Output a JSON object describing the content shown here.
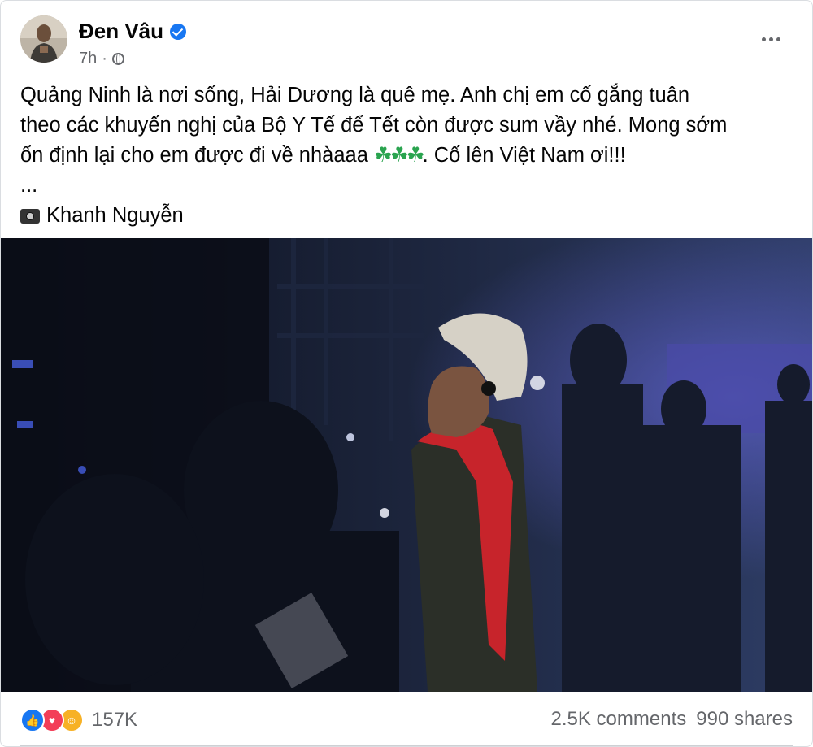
{
  "post": {
    "author": "Đen Vâu",
    "time": "7h",
    "separator": "·",
    "text_lines": [
      "Quảng Ninh là nơi sống, Hải Dương là quê mẹ. Anh chị em cố gắng tuân",
      "theo các khuyến nghị của Bộ Y Tế để Tết còn được sum vầy nhé. Mong sớm",
      "ổn định lại cho em được đi về nhàaaa",
      ". Cố lên Việt Nam ơi!!!"
    ],
    "clovers": "☘☘☘",
    "ellipsis": "...",
    "photo_credit": "Khanh Nguyễn"
  },
  "footer": {
    "reaction_count": "157K",
    "comments": "2.5K comments",
    "shares": "990 shares"
  },
  "icons": [
    "verified-badge-icon",
    "globe-icon",
    "more-options-icon",
    "camera-icon",
    "like-reaction-icon",
    "love-reaction-icon",
    "care-reaction-icon"
  ],
  "colors": {
    "accent": "#1877f2",
    "love": "#f33e58",
    "care": "#f7b125",
    "muted": "#65676b"
  }
}
